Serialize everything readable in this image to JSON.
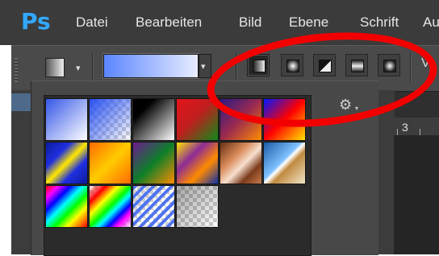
{
  "app": {
    "logo": "Ps"
  },
  "menu": {
    "items": [
      "Datei",
      "Bearbeiten",
      "Bild",
      "Ebene",
      "Schrift",
      "Au"
    ]
  },
  "options": {
    "dropdown_caret": "▾",
    "gradient_types": [
      "linear",
      "radial",
      "angle",
      "reflected",
      "diamond"
    ],
    "selected_type": "linear",
    "cut_off_label": "V"
  },
  "panel": {
    "gear_icon": "⚙",
    "gear_caret": "▾",
    "presets": [
      {
        "name": "blue-white"
      },
      {
        "name": "blue-transparent"
      },
      {
        "name": "black-white"
      },
      {
        "name": "red-green"
      },
      {
        "name": "violet-orange"
      },
      {
        "name": "blue-red-yellow"
      },
      {
        "name": "blue-yellow-blue"
      },
      {
        "name": "orange-yellow-orange"
      },
      {
        "name": "violet-green-orange"
      },
      {
        "name": "yellow-violet-orange-blue"
      },
      {
        "name": "copper"
      },
      {
        "name": "chrome"
      },
      {
        "name": "spectrum"
      },
      {
        "name": "transparent-rainbow"
      },
      {
        "name": "transparent-stripes"
      },
      {
        "name": "neutral-density"
      }
    ]
  },
  "ruler": {
    "label": "3"
  },
  "annotation": {
    "color": "#f20000"
  },
  "colors": {
    "ps_blue": "#31a8ff",
    "menubar": "#3b3b3b"
  }
}
